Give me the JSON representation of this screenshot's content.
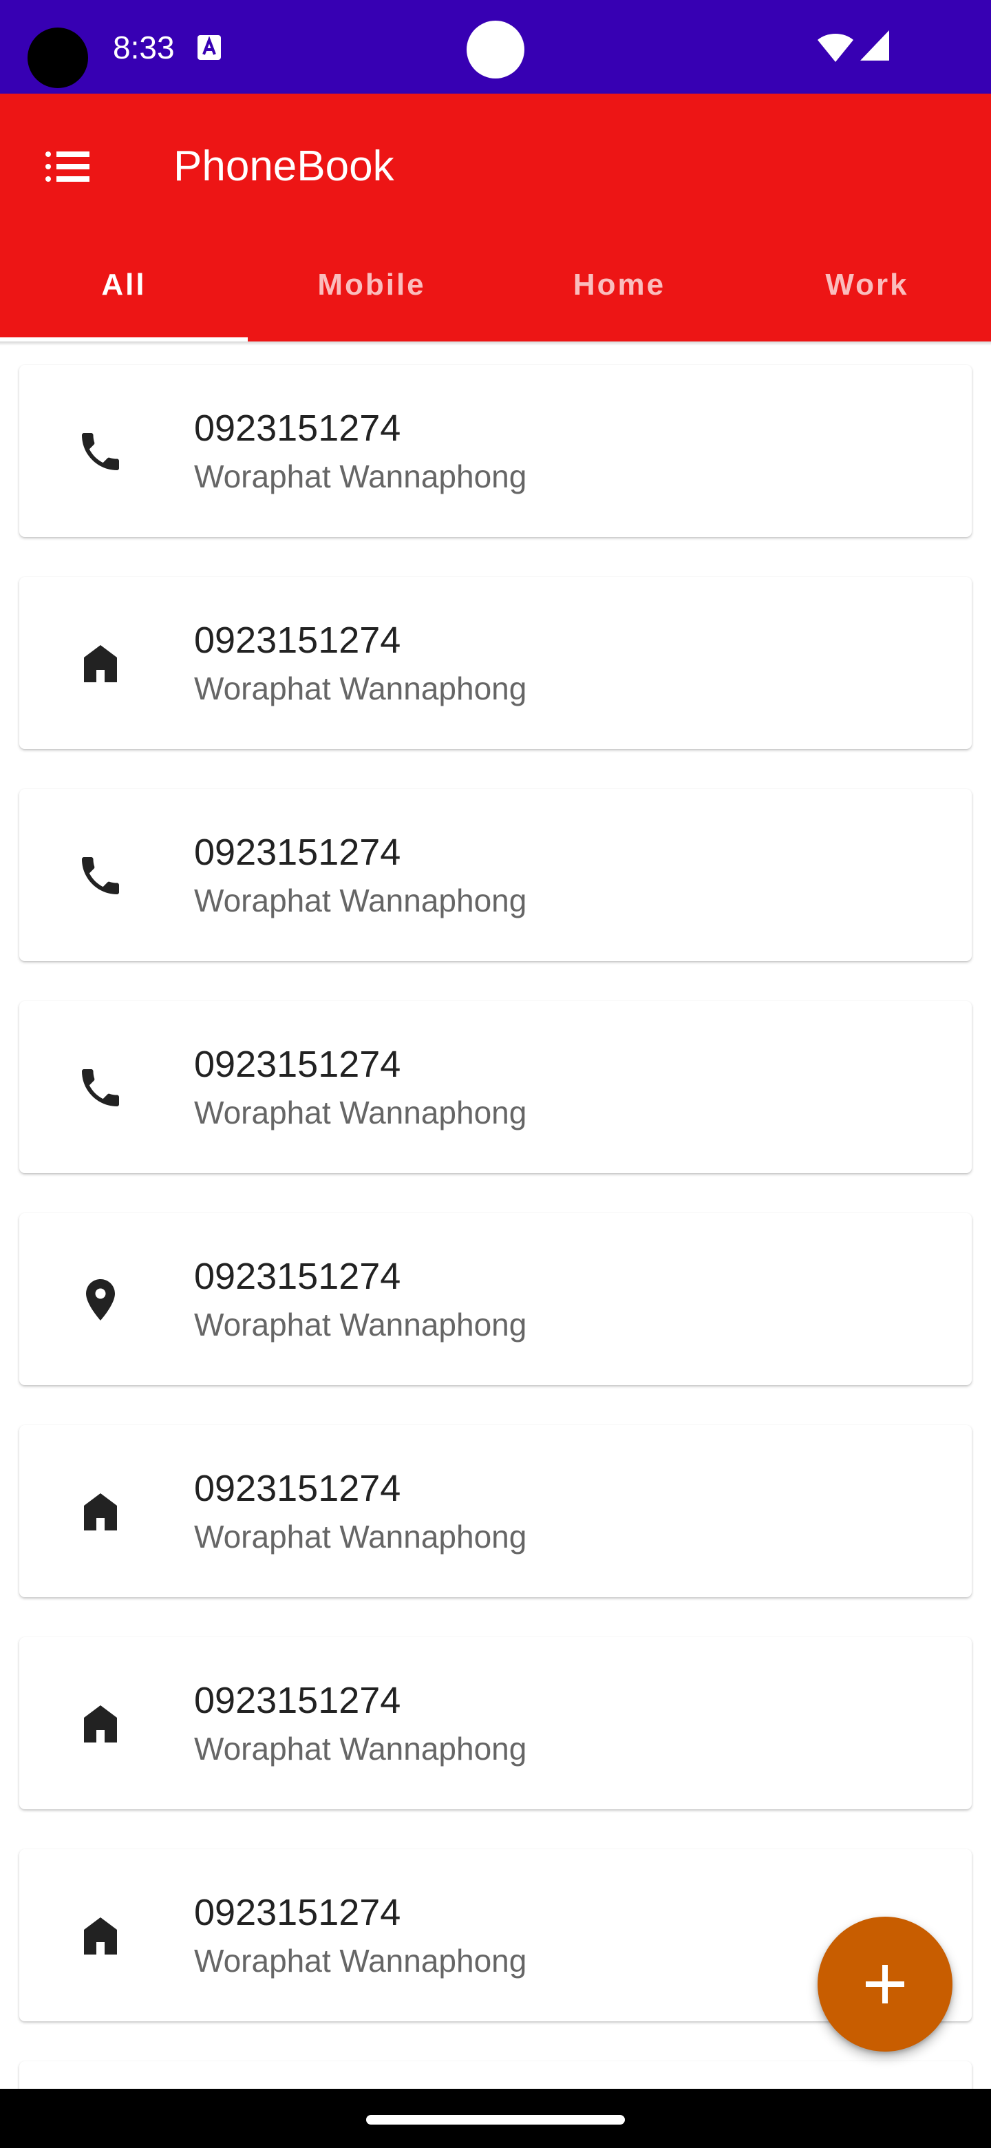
{
  "status_bar": {
    "time": "8:33",
    "icons": [
      "text-input-icon",
      "wifi-icon",
      "cell-signal-icon"
    ],
    "background": "#3700b3"
  },
  "app_bar": {
    "menu_icon": "list-menu-icon",
    "title": "PhoneBook",
    "background": "#ed1515"
  },
  "tabs": [
    {
      "label": "All",
      "selected": true
    },
    {
      "label": "Mobile",
      "selected": false
    },
    {
      "label": "Home",
      "selected": false
    },
    {
      "label": "Work",
      "selected": false
    }
  ],
  "contacts": [
    {
      "icon": "phone-icon",
      "number": "0923151274",
      "name": "Woraphat Wannaphong"
    },
    {
      "icon": "home-icon",
      "number": "0923151274",
      "name": "Woraphat Wannaphong"
    },
    {
      "icon": "phone-icon",
      "number": "0923151274",
      "name": "Woraphat Wannaphong"
    },
    {
      "icon": "phone-icon",
      "number": "0923151274",
      "name": "Woraphat Wannaphong"
    },
    {
      "icon": "location-pin-icon",
      "number": "0923151274",
      "name": "Woraphat Wannaphong"
    },
    {
      "icon": "home-icon",
      "number": "0923151274",
      "name": "Woraphat Wannaphong"
    },
    {
      "icon": "home-icon",
      "number": "0923151274",
      "name": "Woraphat Wannaphong"
    },
    {
      "icon": "home-icon",
      "number": "0923151274",
      "name": "Woraphat Wannaphong"
    }
  ],
  "fab": {
    "icon": "plus-icon",
    "color": "#c85d00"
  },
  "colors": {
    "primary": "#ed1515",
    "status_bar": "#3700b3",
    "accent": "#c85d00",
    "primary_text": "#222222",
    "secondary_text": "#666666"
  }
}
